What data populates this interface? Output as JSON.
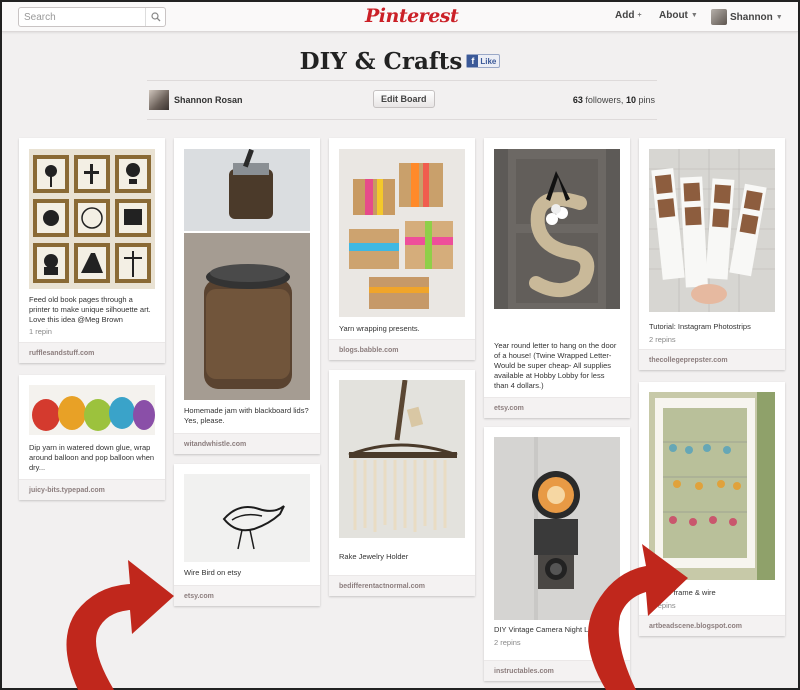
{
  "header": {
    "search_placeholder": "Search",
    "logo": "Pinterest",
    "nav": {
      "add": "Add",
      "about": "About",
      "user": "Shannon"
    }
  },
  "board": {
    "title": "DIY & Crafts",
    "like_label": "Like",
    "owner": "Shannon Rosan",
    "edit_label": "Edit Board",
    "followers_count": "63",
    "followers_text": "followers,",
    "pins_count": "10",
    "pins_text": "pins"
  },
  "pins": [
    {
      "desc": "Feed old book pages through a printer to make unique silhouette art. Love this idea @Meg Brown",
      "repins": "1 repin",
      "source": "rufflesandstuff.com",
      "image": "framed silhouette prints grid"
    },
    {
      "desc": "Dip yarn in watered down glue, wrap around balloon and pop balloon when dry...",
      "repins": "",
      "source": "juicy-bits.typepad.com",
      "image": "colorful yarn balloon lanterns"
    },
    {
      "desc": "Homemade jam with blackboard lids? Yes, please.",
      "repins": "",
      "source": "witandwhistle.com",
      "image": "mason jar with chalkboard lid"
    },
    {
      "desc": "Wire Bird on etsy",
      "repins": "",
      "source": "etsy.com",
      "image": "wire bird sculpture"
    },
    {
      "desc": "Yarn wrapping presents.",
      "repins": "",
      "source": "blogs.babble.com",
      "image": "yarn wrapped gift boxes"
    },
    {
      "desc": "Rake Jewelry Holder",
      "repins": "",
      "source": "bedifferentactnormal.com",
      "image": "rake with hanging necklaces"
    },
    {
      "desc": "Year round letter to hang on the door of a house! (Twine Wrapped Letter- Would be super cheap- All supplies available at Hobby Lobby for less than 4 dollars.)",
      "repins": "",
      "source": "etsy.com",
      "image": "twine wrapped letter S on door"
    },
    {
      "desc": "DIY Vintage Camera Night Light",
      "repins": "2 repins",
      "source": "instructables.com",
      "image": "vintage camera lamp"
    },
    {
      "desc": "Tutorial: Instagram Photostrips",
      "repins": "2 repins",
      "source": "thecollegeprepster.com",
      "image": "instagram photo strips"
    },
    {
      "desc": "picture frame & wire",
      "repins": "2 repins",
      "source": "artbeadscene.blogspot.com",
      "image": "earring display frame"
    }
  ],
  "colors": {
    "brand": "#cb2027",
    "background": "#f2f0f0",
    "arrow": "#c0271c"
  }
}
